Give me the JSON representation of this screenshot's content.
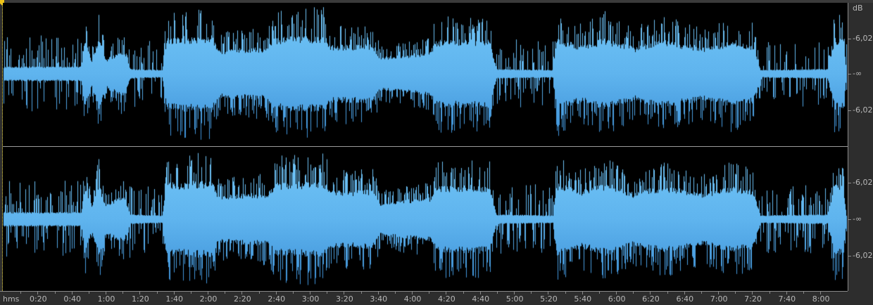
{
  "scale": {
    "unit_label": "dB",
    "level_label": "-6,02",
    "zero_label": "-∞"
  },
  "ruler": {
    "unit_label": "hms",
    "ticks": [
      {
        "t": 20,
        "label": "0:20"
      },
      {
        "t": 40,
        "label": "0:40"
      },
      {
        "t": 60,
        "label": "1:00"
      },
      {
        "t": 80,
        "label": "1:20"
      },
      {
        "t": 100,
        "label": "1:40"
      },
      {
        "t": 120,
        "label": "2:00"
      },
      {
        "t": 140,
        "label": "2:20"
      },
      {
        "t": 160,
        "label": "2:40"
      },
      {
        "t": 180,
        "label": "3:00"
      },
      {
        "t": 200,
        "label": "3:20"
      },
      {
        "t": 220,
        "label": "3:40"
      },
      {
        "t": 240,
        "label": "4:00"
      },
      {
        "t": 260,
        "label": "4:20"
      },
      {
        "t": 280,
        "label": "4:40"
      },
      {
        "t": 300,
        "label": "5:00"
      },
      {
        "t": 320,
        "label": "5:20"
      },
      {
        "t": 340,
        "label": "5:40"
      },
      {
        "t": 360,
        "label": "6:00"
      },
      {
        "t": 380,
        "label": "6:20"
      },
      {
        "t": 400,
        "label": "6:40"
      },
      {
        "t": 420,
        "label": "7:00"
      },
      {
        "t": 440,
        "label": "7:20"
      },
      {
        "t": 460,
        "label": "7:40"
      },
      {
        "t": 480,
        "label": "8:00"
      }
    ]
  },
  "waveform": {
    "channels": 2,
    "duration_s": 496,
    "color_light": "#72c6f7",
    "color_dark": "#3a8ed6",
    "envelope": [
      [
        0,
        0.15
      ],
      [
        45.5,
        0.15
      ],
      [
        47.6,
        0.7
      ],
      [
        51.7,
        0.3
      ],
      [
        55.9,
        0.75
      ],
      [
        60,
        0.3
      ],
      [
        70.3,
        0.5
      ],
      [
        74.5,
        0.1
      ],
      [
        93.1,
        0.08
      ],
      [
        95.6,
        0.75
      ],
      [
        122,
        0.8
      ],
      [
        126.2,
        0.5
      ],
      [
        155.1,
        0.55
      ],
      [
        159.3,
        0.75
      ],
      [
        188.2,
        0.8
      ],
      [
        192.4,
        0.6
      ],
      [
        217.2,
        0.6
      ],
      [
        221.3,
        0.35
      ],
      [
        250.3,
        0.45
      ],
      [
        254.5,
        0.7
      ],
      [
        285.5,
        0.7
      ],
      [
        289.6,
        0.1
      ],
      [
        322.7,
        0.08
      ],
      [
        324.8,
        0.75
      ],
      [
        339.3,
        0.6
      ],
      [
        353.7,
        0.75
      ],
      [
        370.3,
        0.55
      ],
      [
        386.8,
        0.7
      ],
      [
        411.7,
        0.55
      ],
      [
        428.2,
        0.7
      ],
      [
        440.6,
        0.6
      ],
      [
        444.8,
        0.08
      ],
      [
        484.1,
        0.1
      ],
      [
        488.2,
        0.75
      ],
      [
        493.6,
        0.7
      ],
      [
        495.3,
        0.05
      ]
    ]
  }
}
